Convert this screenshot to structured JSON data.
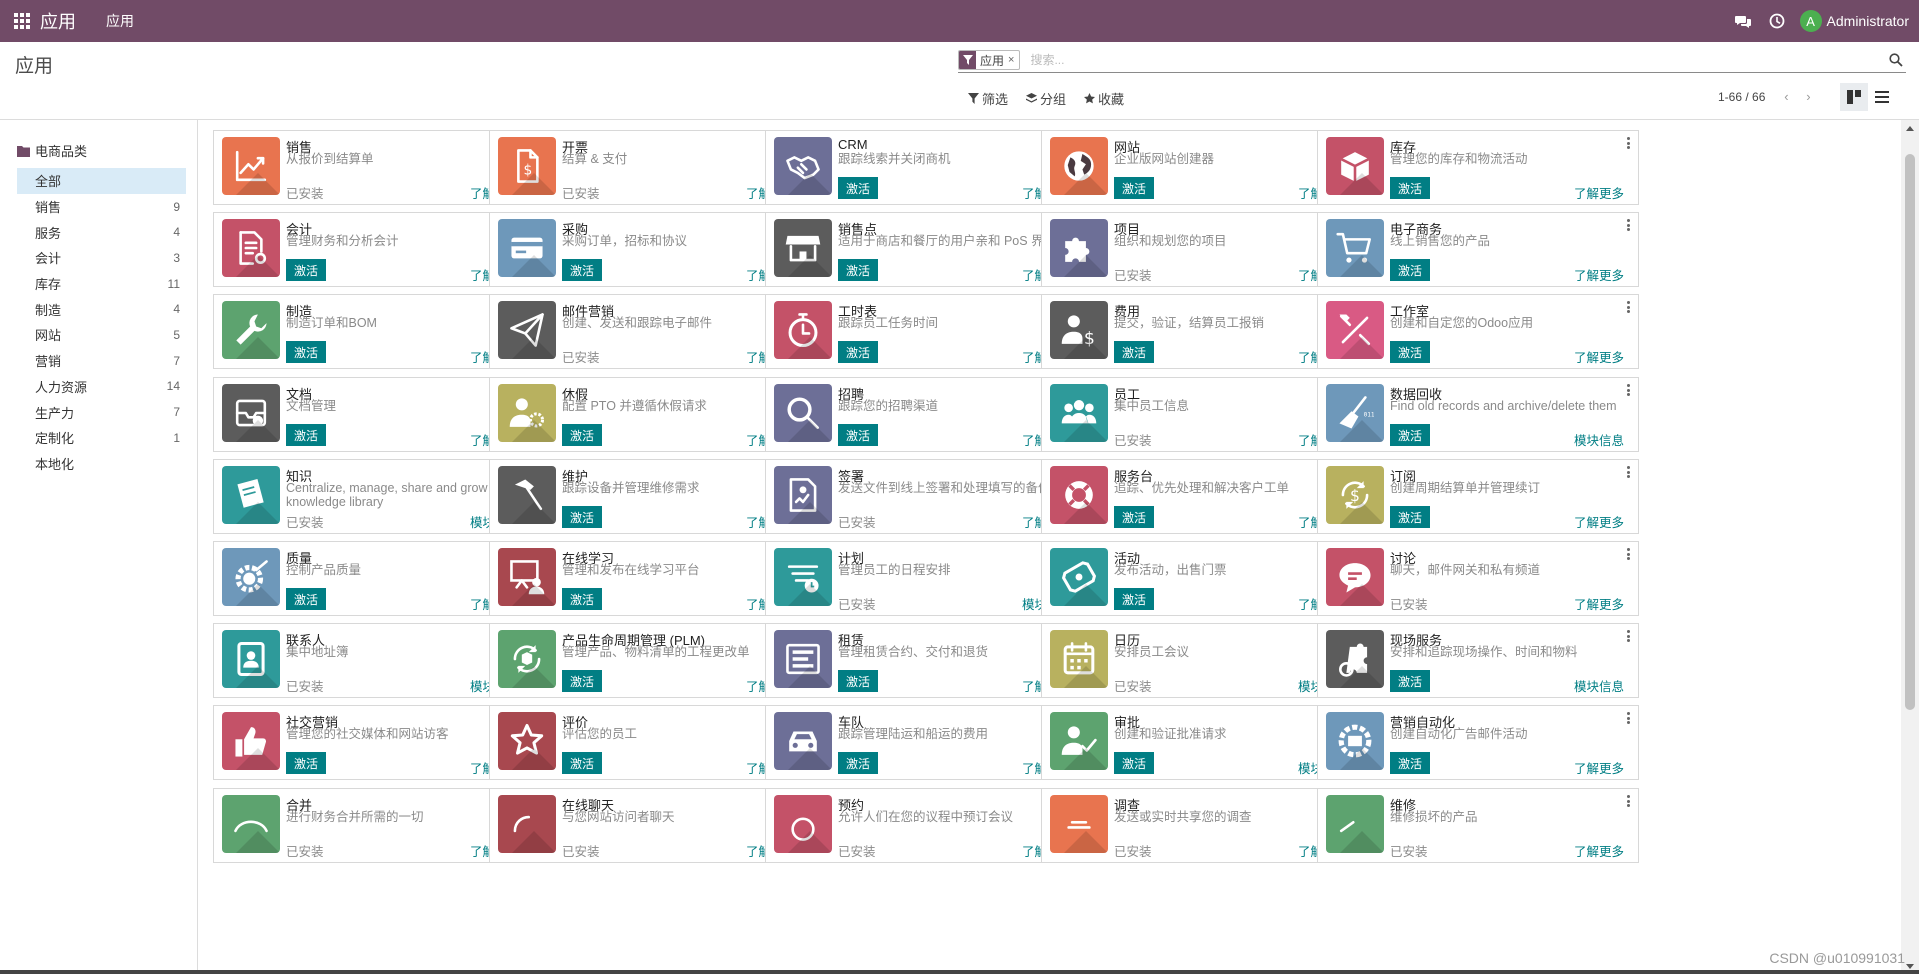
{
  "navbar": {
    "app_name": "应用",
    "menu_item": "应用",
    "user": "Administrator",
    "avatar_letter": "A",
    "color": "#714b67"
  },
  "control_panel": {
    "breadcrumb": "应用",
    "search": {
      "facet_value": "应用",
      "facet_remove": "×",
      "placeholder": "搜索..."
    },
    "filters": [
      "筛选",
      "分组",
      "收藏"
    ],
    "pager": "1-66 / 66"
  },
  "sidebar": {
    "category_title": "电商品类",
    "items": [
      {
        "label": "全部",
        "count": "",
        "active": true
      },
      {
        "label": "销售",
        "count": "9"
      },
      {
        "label": "服务",
        "count": "4"
      },
      {
        "label": "会计",
        "count": "3"
      },
      {
        "label": "库存",
        "count": "11"
      },
      {
        "label": "制造",
        "count": "4"
      },
      {
        "label": "网站",
        "count": "5"
      },
      {
        "label": "营销",
        "count": "7"
      },
      {
        "label": "人力资源",
        "count": "14"
      },
      {
        "label": "生产力",
        "count": "7"
      },
      {
        "label": "定制化",
        "count": "1"
      },
      {
        "label": "本地化",
        "count": ""
      }
    ]
  },
  "labels": {
    "installed": "已安装",
    "activate": "激活",
    "learn_more": "了解更多",
    "module_info": "模块信息"
  },
  "apps": [
    {
      "name": "销售",
      "summary": "从报价到结算单",
      "state": "installed",
      "link": "learn_more",
      "icon": "chart-icon",
      "color": "#e8744f"
    },
    {
      "name": "开票",
      "summary": "结算 & 支付",
      "state": "installed",
      "link": "learn_more",
      "icon": "invoice-icon",
      "color": "#e8744f"
    },
    {
      "name": "CRM",
      "summary": "跟踪线索并关闭商机",
      "state": "activate",
      "link": "learn_more",
      "icon": "handshake-icon",
      "color": "#6d6f97"
    },
    {
      "name": "网站",
      "summary": "企业版网站创建器",
      "state": "activate",
      "link": "learn_more",
      "icon": "globe-icon",
      "color": "#e8744f"
    },
    {
      "name": "库存",
      "summary": "管理您的库存和物流活动",
      "state": "activate",
      "link": "learn_more",
      "icon": "box-icon",
      "color": "#c45268"
    },
    {
      "name": "会计",
      "summary": "管理财务和分析会计",
      "state": "activate",
      "link": "learn_more",
      "icon": "document-gear-icon",
      "color": "#c45268"
    },
    {
      "name": "采购",
      "summary": "采购订单，招标和协议",
      "state": "activate",
      "link": "learn_more",
      "icon": "credit-card-icon",
      "color": "#6e98ba"
    },
    {
      "name": "销售点",
      "summary": "适用于商店和餐厅的用户亲和 PoS 界面",
      "state": "activate",
      "link": "learn_more",
      "icon": "shop-icon",
      "color": "#5c5c5c"
    },
    {
      "name": "项目",
      "summary": "组织和规划您的项目",
      "state": "installed",
      "link": "learn_more",
      "icon": "puzzle-icon",
      "color": "#6d6f97"
    },
    {
      "name": "电子商务",
      "summary": "线上销售您的产品",
      "state": "activate",
      "link": "learn_more",
      "icon": "cart-icon",
      "color": "#6e98ba"
    },
    {
      "name": "制造",
      "summary": "制造订单和BOM",
      "state": "activate",
      "link": "learn_more",
      "icon": "wrench-icon",
      "color": "#5da36f"
    },
    {
      "name": "邮件营销",
      "summary": "创建、发送和跟踪电子邮件",
      "state": "installed",
      "link": "learn_more",
      "icon": "paper-plane-icon",
      "color": "#5c5c5c"
    },
    {
      "name": "工时表",
      "summary": "跟踪员工任务时间",
      "state": "activate",
      "link": "learn_more",
      "icon": "stopwatch-icon",
      "color": "#c45268"
    },
    {
      "name": "费用",
      "summary": "提交，验证，结算员工报销",
      "state": "activate",
      "link": "learn_more",
      "icon": "user-dollar-icon",
      "color": "#5c5c5c"
    },
    {
      "name": "工作室",
      "summary": "创建和自定您的Odoo应用",
      "state": "activate",
      "link": "learn_more",
      "icon": "tools-icon",
      "color": "#d95a84"
    },
    {
      "name": "文档",
      "summary": "文档管理",
      "state": "activate",
      "link": "learn_more",
      "icon": "inbox-icon",
      "color": "#5c5c5c"
    },
    {
      "name": "休假",
      "summary": "配置 PTO 并遵循休假请求",
      "state": "activate",
      "link": "learn_more",
      "icon": "user-gear-icon",
      "color": "#b8b15f"
    },
    {
      "name": "招聘",
      "summary": "跟踪您的招聘渠道",
      "state": "activate",
      "link": "learn_more",
      "icon": "magnifier-icon",
      "color": "#6d6f97"
    },
    {
      "name": "员工",
      "summary": "集中员工信息",
      "state": "installed",
      "link": "learn_more",
      "icon": "users-icon",
      "color": "#2e9a9a"
    },
    {
      "name": "数据回收",
      "summary": "Find old records and archive/delete them",
      "state": "activate",
      "link": "module_info",
      "icon": "broom-icon",
      "color": "#6e98ba"
    },
    {
      "name": "知识",
      "summary": "Centralize, manage, share and grow your knowledge library",
      "state": "installed",
      "link": "module_info",
      "icon": "book-icon",
      "color": "#2e9a9a"
    },
    {
      "name": "维护",
      "summary": "跟踪设备并管理维修需求",
      "state": "activate",
      "link": "learn_more",
      "icon": "hammer-icon",
      "color": "#5c5c5c"
    },
    {
      "name": "签署",
      "summary": "发送文件到线上签署和处理填写的备份",
      "state": "installed",
      "link": "learn_more",
      "icon": "signature-icon",
      "color": "#6d6f97"
    },
    {
      "name": "服务台",
      "summary": "追踪、优先处理和解决客户工单",
      "state": "activate",
      "link": "learn_more",
      "icon": "lifebuoy-icon",
      "color": "#c45268"
    },
    {
      "name": "订阅",
      "summary": "创建周期结算单并管理续订",
      "state": "activate",
      "link": "learn_more",
      "icon": "recurring-dollar-icon",
      "color": "#b8b15f"
    },
    {
      "name": "质量",
      "summary": "控制产品质量",
      "state": "activate",
      "link": "learn_more",
      "icon": "quality-gear-icon",
      "color": "#6e98ba"
    },
    {
      "name": "在线学习",
      "summary": "管理和发布在线学习平台",
      "state": "activate",
      "link": "learn_more",
      "icon": "presentation-icon",
      "color": "#a8484f"
    },
    {
      "name": "计划",
      "summary": "管理员工的日程安排",
      "state": "installed",
      "link": "module_info",
      "icon": "planning-icon",
      "color": "#2e9a9a"
    },
    {
      "name": "活动",
      "summary": "发布活动，出售门票",
      "state": "activate",
      "link": "learn_more",
      "icon": "ticket-icon",
      "color": "#2e9a9a"
    },
    {
      "name": "讨论",
      "summary": "聊天，邮件网关和私有频道",
      "state": "installed",
      "link": "learn_more",
      "icon": "chat-bubble-icon",
      "color": "#c45268"
    },
    {
      "name": "联系人",
      "summary": "集中地址簿",
      "state": "installed",
      "link": "module_info",
      "icon": "address-book-icon",
      "color": "#2e9a9a"
    },
    {
      "name": "产品生命周期管理 (PLM)",
      "summary": "管理产品、物料清单的工程更改单",
      "state": "activate",
      "link": "learn_more",
      "icon": "cycle-box-icon",
      "color": "#5da36f"
    },
    {
      "name": "租赁",
      "summary": "管理租赁合约、交付和退货",
      "state": "activate",
      "link": "learn_more",
      "icon": "rental-icon",
      "color": "#6d6f97"
    },
    {
      "name": "日历",
      "summary": "安排员工会议",
      "state": "installed",
      "link": "module_info",
      "icon": "calendar-icon",
      "color": "#b8b15f"
    },
    {
      "name": "现场服务",
      "summary": "安排和追踪现场操作、时间和物料",
      "state": "activate",
      "link": "module_info",
      "icon": "field-service-icon",
      "color": "#5c5c5c"
    },
    {
      "name": "社交营销",
      "summary": "管理您的社交媒体和网站访客",
      "state": "activate",
      "link": "learn_more",
      "icon": "thumbs-up-icon",
      "color": "#c45268"
    },
    {
      "name": "评价",
      "summary": "评估您的员工",
      "state": "activate",
      "link": "learn_more",
      "icon": "star-icon",
      "color": "#a8484f"
    },
    {
      "name": "车队",
      "summary": "跟踪管理陆运和船运的费用",
      "state": "activate",
      "link": "learn_more",
      "icon": "car-icon",
      "color": "#6d6f97"
    },
    {
      "name": "审批",
      "summary": "创建和验证批准请求",
      "state": "activate",
      "link": "module_info",
      "icon": "user-check-icon",
      "color": "#5da36f"
    },
    {
      "name": "营销自动化",
      "summary": "创建自动化广告邮件活动",
      "state": "activate",
      "link": "learn_more",
      "icon": "envelope-gear-icon",
      "color": "#6e98ba"
    },
    {
      "name": "合并",
      "summary": "进行财务合并所需的一切",
      "state": "installed",
      "link": "learn_more",
      "icon": "consolidation-icon",
      "color": "#5da36f"
    },
    {
      "name": "在线聊天",
      "summary": "与您网站访问者聊天",
      "state": "installed",
      "link": "learn_more",
      "icon": "livechat-icon",
      "color": "#a8484f"
    },
    {
      "name": "预约",
      "summary": "允许人们在您的议程中预订会议",
      "state": "installed",
      "link": "learn_more",
      "icon": "appointment-icon",
      "color": "#c45268"
    },
    {
      "name": "调查",
      "summary": "发送或实时共享您的调查",
      "state": "installed",
      "link": "learn_more",
      "icon": "survey-icon",
      "color": "#e8744f"
    },
    {
      "name": "维修",
      "summary": "维修损坏的产品",
      "state": "installed",
      "link": "learn_more",
      "icon": "repair-icon",
      "color": "#5da36f"
    }
  ],
  "watermark": "CSDN @u010991031"
}
